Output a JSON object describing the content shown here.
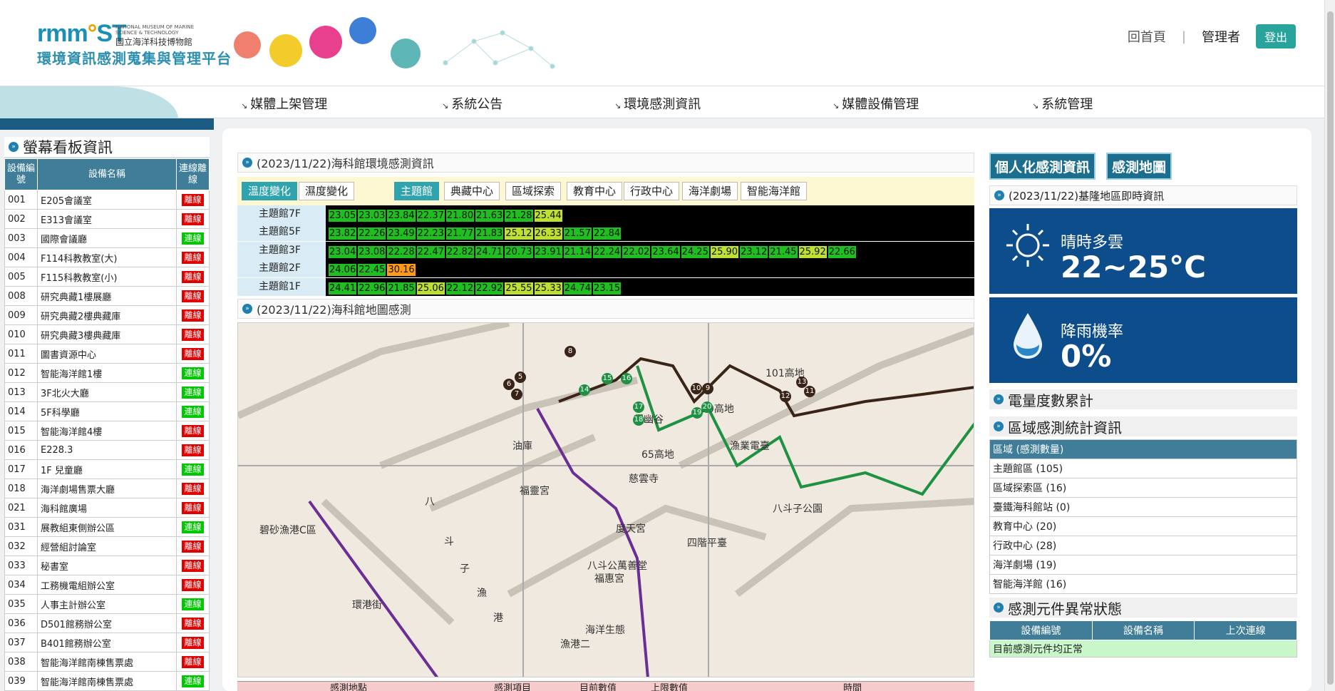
{
  "header": {
    "brand_main": "rmm",
    "brand_accent": "ST",
    "brand_sep": "°",
    "museum_en": "NATIONAL MUSEUM OF MARINE SCIENCE & TECHNOLOGY",
    "museum_zh": "國立海洋科技博物館",
    "platform": "環境資訊感測蒐集與管理平台",
    "home": "回首頁",
    "separator": "|",
    "admin": "管理者",
    "logout": "登出"
  },
  "nav": [
    "媒體上架管理",
    "系統公告",
    "環境感測資訊",
    "媒體設備管理",
    "系統管理"
  ],
  "left_panel": {
    "title": "螢幕看板資訊",
    "col_id": "設備編號",
    "col_name": "設備名稱",
    "col_status": "連線離線",
    "rows": [
      {
        "id": "001",
        "name": "E205會議室",
        "status": "離線",
        "on": false
      },
      {
        "id": "002",
        "name": "E313會議室",
        "status": "離線",
        "on": false
      },
      {
        "id": "003",
        "name": "國際會議廳",
        "status": "連線",
        "on": true
      },
      {
        "id": "004",
        "name": "F114科教教室(大)",
        "status": "離線",
        "on": false
      },
      {
        "id": "005",
        "name": "F115科教教室(小)",
        "status": "離線",
        "on": false
      },
      {
        "id": "008",
        "name": "研究典藏1樓展廳",
        "status": "離線",
        "on": false
      },
      {
        "id": "009",
        "name": "研究典藏2樓典藏庫",
        "status": "離線",
        "on": false
      },
      {
        "id": "010",
        "name": "研究典藏3樓典藏庫",
        "status": "離線",
        "on": false
      },
      {
        "id": "011",
        "name": "圖書資源中心",
        "status": "離線",
        "on": false
      },
      {
        "id": "012",
        "name": "智能海洋館1樓",
        "status": "連線",
        "on": true
      },
      {
        "id": "013",
        "name": "3F北火大廳",
        "status": "連線",
        "on": true
      },
      {
        "id": "014",
        "name": "5F科學廳",
        "status": "連線",
        "on": true
      },
      {
        "id": "015",
        "name": "智能海洋館4樓",
        "status": "離線",
        "on": false
      },
      {
        "id": "016",
        "name": "E228.3",
        "status": "離線",
        "on": false
      },
      {
        "id": "017",
        "name": "1F 兒童廳",
        "status": "連線",
        "on": true
      },
      {
        "id": "018",
        "name": "海洋劇場售票大廳",
        "status": "離線",
        "on": false
      },
      {
        "id": "021",
        "name": "海科館廣場",
        "status": "離線",
        "on": false
      },
      {
        "id": "031",
        "name": "展教組東側辦公區",
        "status": "連線",
        "on": true
      },
      {
        "id": "032",
        "name": "經營組討論室",
        "status": "離線",
        "on": false
      },
      {
        "id": "033",
        "name": "秘書室",
        "status": "離線",
        "on": false
      },
      {
        "id": "034",
        "name": "工務機電組辦公室",
        "status": "離線",
        "on": false
      },
      {
        "id": "035",
        "name": "人事主計辦公室",
        "status": "連線",
        "on": true
      },
      {
        "id": "036",
        "name": "D501館務辦公室",
        "status": "離線",
        "on": false
      },
      {
        "id": "037",
        "name": "B401館務辦公室",
        "status": "離線",
        "on": false
      },
      {
        "id": "038",
        "name": "智能海洋館南棟售票處",
        "status": "離線",
        "on": false
      },
      {
        "id": "039",
        "name": "智能海洋館南棟售票處",
        "status": "連線",
        "on": true
      }
    ]
  },
  "env": {
    "title": "(2023/11/22)海科館環境感測資訊",
    "tabs": [
      "溫度變化",
      "濕度變化"
    ],
    "zones": [
      "主題館",
      "典藏中心",
      "區域探索",
      "教育中心",
      "行政中心",
      "海洋劇場",
      "智能海洋館"
    ],
    "floors": [
      {
        "label": "主題館7F",
        "values": [
          "23.05",
          "23.03",
          "23.84",
          "22.37",
          "21.80",
          "21.63",
          "21.28",
          "25.44"
        ]
      },
      {
        "label": "主題館5F",
        "values": [
          "23.82",
          "22.26",
          "23.49",
          "22.23",
          "21.77",
          "21.83",
          "25.12",
          "26.33",
          "21.57",
          "22.84"
        ]
      },
      {
        "label": "主題館3F",
        "values": [
          "23.04",
          "23.08",
          "22.28",
          "22.47",
          "22.82",
          "24.71",
          "20.73",
          "23.91",
          "21.14",
          "22.24",
          "22.02",
          "23.64",
          "24.25",
          "25.90",
          "23.12",
          "21.45",
          "25.92",
          "22.66"
        ]
      },
      {
        "label": "主題館2F",
        "values": [
          "24.06",
          "22.45",
          "30.16"
        ]
      },
      {
        "label": "主題館1F",
        "values": [
          "24.41",
          "22.96",
          "21.85",
          "25.06",
          "22.12",
          "22.92",
          "25.55",
          "25.33",
          "24.74",
          "23.15"
        ]
      }
    ]
  },
  "map": {
    "title": "(2023/11/22)海科館地圖感測",
    "labels": [
      "101高地",
      "80高地",
      "望幽谷",
      "65高地",
      "漁業電臺",
      "油庫",
      "福靈宮",
      "慈雲寺",
      "度天宮",
      "四階平臺",
      "八斗子公園",
      "碧砂漁港C區",
      "八斗公萬善堂",
      "福惠宮",
      "八",
      "斗",
      "子",
      "漁",
      "港",
      "環港街",
      "海洋生態",
      "漁港二"
    ],
    "markers": [
      "5",
      "6",
      "7",
      "8",
      "9",
      "10",
      "11",
      "12",
      "13",
      "14",
      "15",
      "16",
      "17",
      "18",
      "19",
      "20"
    ]
  },
  "bottom_table": {
    "headers": [
      "感測地點",
      "感測項目",
      "目前數值",
      "上限數值",
      "時間"
    ]
  },
  "right": {
    "btn_personal": "個人化感測資訊",
    "btn_map": "感測地圖",
    "weather_title": "(2023/11/22)基隆地區即時資訊",
    "weather_label": "晴時多雲",
    "temp": "22~25°C",
    "rain_label": "降雨機率",
    "rain": "0%",
    "power_title": "電量度數累計",
    "zone_title": "區域感測統計資訊",
    "zone_header": "區域 (感測數量)",
    "zones": [
      "主題館區 (105)",
      "區域探索區 (16)",
      "臺鐵海科館站 (0)",
      "教育中心 (20)",
      "行政中心 (28)",
      "海洋劇場 (19)",
      "智能海洋館 (16)"
    ],
    "abn_title": "感測元件異常狀態",
    "abn_headers": [
      "設備編號",
      "設備名稱",
      "上次連線"
    ],
    "abn_msg": "目前感測元件均正常"
  }
}
